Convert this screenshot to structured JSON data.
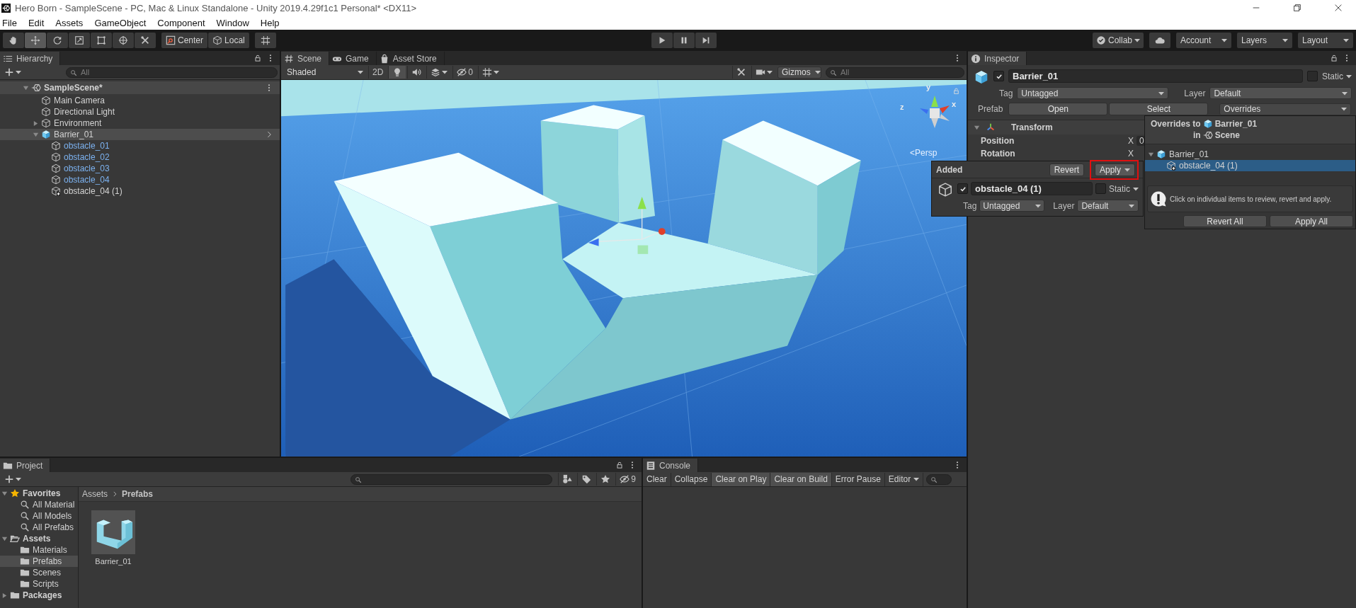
{
  "window": {
    "title": "Hero Born - SampleScene - PC, Mac & Linux Standalone - Unity 2019.4.29f1c1 Personal* <DX11>"
  },
  "menu": [
    "File",
    "Edit",
    "Assets",
    "GameObject",
    "Component",
    "Window",
    "Help"
  ],
  "toolbar": {
    "tools": [
      {
        "kind": "hand",
        "selected": false
      },
      {
        "kind": "move",
        "selected": true
      },
      {
        "kind": "rotate",
        "selected": false
      },
      {
        "kind": "scale",
        "selected": false
      },
      {
        "kind": "rect",
        "selected": false
      },
      {
        "kind": "transform",
        "selected": false
      },
      {
        "kind": "custom",
        "selected": false
      }
    ],
    "pivot_mode": "Center",
    "pivot_rotation": "Local",
    "playback": [
      {
        "kind": "play",
        "selected": false
      },
      {
        "kind": "pause",
        "selected": false
      },
      {
        "kind": "step",
        "selected": false
      }
    ],
    "collab": "Collab",
    "account": "Account",
    "layers": "Layers",
    "layout": "Layout"
  },
  "hierarchy": {
    "tab": "Hierarchy",
    "search_placeholder": "All",
    "items": [
      {
        "label": "SampleScene*",
        "kind": "scene",
        "expanded": true,
        "selected": false,
        "children": [
          {
            "label": "Main Camera",
            "kind": "object",
            "selected": false
          },
          {
            "label": "Directional Light",
            "kind": "object",
            "selected": false
          },
          {
            "label": "Environment",
            "kind": "object",
            "expanded": false,
            "selected": false
          },
          {
            "label": "Barrier_01",
            "kind": "prefab",
            "expanded": true,
            "selected": true,
            "children": [
              {
                "label": "obstacle_01",
                "kind": "prefab_part",
                "selected": false
              },
              {
                "label": "obstacle_02",
                "kind": "prefab_part",
                "selected": false
              },
              {
                "label": "obstacle_03",
                "kind": "prefab_part",
                "selected": false
              },
              {
                "label": "obstacle_04",
                "kind": "prefab_part",
                "selected": false
              },
              {
                "label": "obstacle_04 (1)",
                "kind": "added",
                "selected": false
              }
            ]
          }
        ]
      }
    ]
  },
  "scene_view": {
    "tabs": [
      {
        "kind": "scene",
        "label": "Scene",
        "selected": true
      },
      {
        "kind": "game",
        "label": "Game",
        "selected": false
      },
      {
        "kind": "store",
        "label": "Asset Store",
        "selected": false
      }
    ],
    "shading": "Shaded",
    "mode_2d": "2D",
    "hidden_count": "0",
    "gizmos": "Gizmos",
    "search_placeholder": "All",
    "axes": [
      "y",
      "x",
      "z"
    ],
    "projection": "<Persp"
  },
  "inspector": {
    "tab": "Inspector",
    "object": {
      "active": true,
      "name": "Barrier_01",
      "static": false,
      "static_label": "Static",
      "tag_label": "Tag",
      "tag": "Untagged",
      "layer_label": "Layer",
      "layer": "Default"
    },
    "prefab": {
      "label": "Prefab",
      "buttons": [
        "Open",
        "Select"
      ],
      "overrides": "Overrides"
    },
    "component": {
      "title": "Transform",
      "expanded": true,
      "rows": [
        {
          "label": "Position",
          "axis": "X",
          "value": "0"
        },
        {
          "label": "Rotation",
          "axis": "X"
        }
      ]
    }
  },
  "added_popup": {
    "title": "Added",
    "revert": "Revert",
    "apply": {
      "label": "Apply",
      "highlighted": true
    },
    "object": {
      "active": true,
      "name": "obstacle_04 (1)",
      "static": false,
      "static_label": "Static",
      "tag_label": "Tag",
      "tag": "Untagged",
      "layer_label": "Layer",
      "layer": "Default"
    }
  },
  "overrides_popup": {
    "heading": "Overrides to",
    "prefab": "Barrier_01",
    "in_label": "in",
    "scene": "Scene",
    "tree": [
      {
        "label": "Barrier_01",
        "kind": "prefab",
        "expanded": true,
        "selected": false,
        "children": [
          {
            "label": "obstacle_04 (1)",
            "kind": "added",
            "selected": true
          }
        ]
      }
    ],
    "hint": "Click on individual items to review, revert and apply.",
    "buttons": [
      "Revert All",
      "Apply All"
    ]
  },
  "project": {
    "tab": "Project",
    "hidden_count": "9",
    "tree": [
      {
        "label": "Favorites",
        "kind": "favorites",
        "expanded": true,
        "selected": false,
        "children": [
          {
            "label": "All Material",
            "kind": "search",
            "selected": false
          },
          {
            "label": "All Models",
            "kind": "search",
            "selected": false
          },
          {
            "label": "All Prefabs",
            "kind": "search",
            "selected": false
          }
        ]
      },
      {
        "label": "Assets",
        "kind": "folder",
        "expanded": true,
        "selected": false,
        "children": [
          {
            "label": "Materials",
            "kind": "folder",
            "selected": false
          },
          {
            "label": "Prefabs",
            "kind": "folder",
            "selected": true
          },
          {
            "label": "Scenes",
            "kind": "folder",
            "selected": false
          },
          {
            "label": "Scripts",
            "kind": "folder",
            "selected": false
          }
        ]
      },
      {
        "label": "Packages",
        "kind": "folder",
        "expanded": false,
        "selected": false
      }
    ],
    "breadcrumb": [
      {
        "label": "Assets",
        "current": false
      },
      {
        "label": "Prefabs",
        "current": true
      }
    ],
    "assets": [
      {
        "name": "Barrier_01"
      }
    ]
  },
  "console": {
    "tab": "Console",
    "buttons": [
      {
        "label": "Clear",
        "on": false
      },
      {
        "label": "Collapse",
        "on": false
      },
      {
        "label": "Clear on Play",
        "on": true
      },
      {
        "label": "Clear on Build",
        "on": true
      },
      {
        "label": "Error Pause",
        "on": false
      }
    ],
    "filter": "Editor"
  }
}
